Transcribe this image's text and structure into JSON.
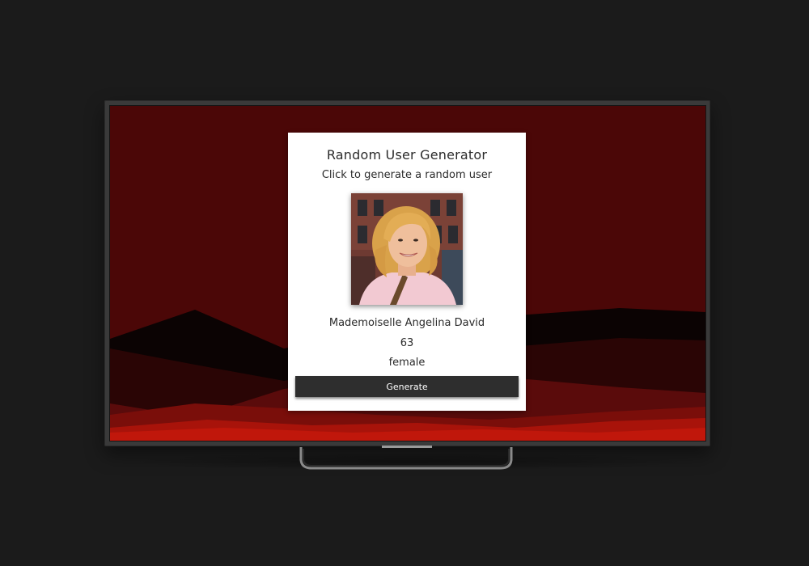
{
  "card": {
    "title": "Random User Generator",
    "subtitle": "Click to generate a random user"
  },
  "user": {
    "name": "Mademoiselle Angelina David",
    "age": "63",
    "gender": "female",
    "photo_icon": "user-portrait"
  },
  "actions": {
    "generate_label": "Generate"
  },
  "colors": {
    "page_background": "#1b1b1b",
    "screen_background": "#4c0808",
    "card_background": "#ffffff",
    "button_background": "#2e2e2e",
    "accent_red": "#b3140a"
  }
}
